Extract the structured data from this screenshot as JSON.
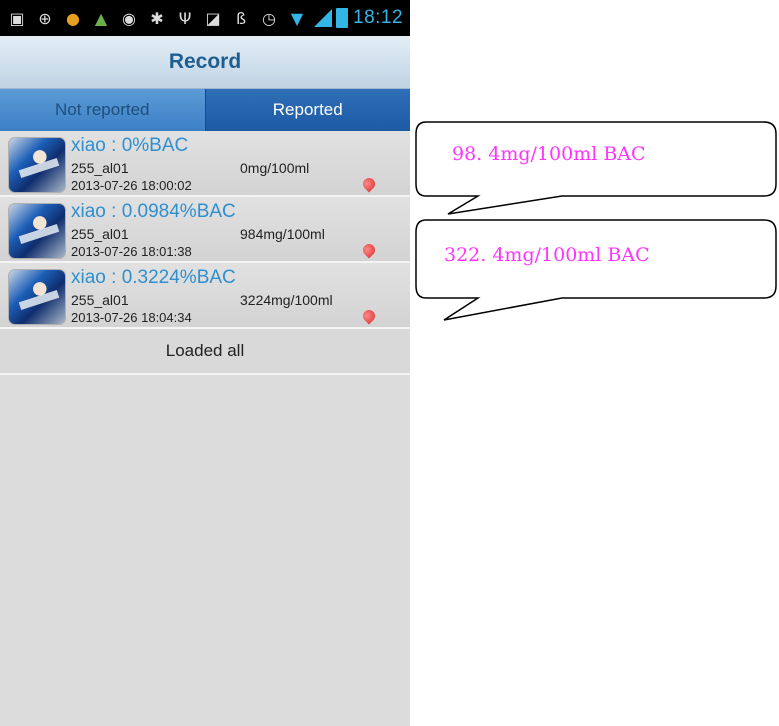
{
  "status_bar": {
    "time": "18:12",
    "icons": [
      "notification-icon",
      "gps-icon",
      "app-icon",
      "android-icon",
      "shield-icon",
      "debug-icon",
      "usb-icon",
      "image-icon",
      "bluetooth-icon",
      "alarm-icon",
      "wifi-icon",
      "signal-icon",
      "battery-icon"
    ]
  },
  "header": {
    "title": "Record"
  },
  "tabs": [
    {
      "label": "Not reported"
    },
    {
      "label": "Reported"
    }
  ],
  "records": [
    {
      "title": "xiao  : 0%BAC",
      "device": "255_al01",
      "value": "0mg/100ml",
      "time": "2013-07-26 18:00:02"
    },
    {
      "title": "xiao  : 0.0984%BAC",
      "device": "255_al01",
      "value": "984mg/100ml",
      "time": "2013-07-26 18:01:38"
    },
    {
      "title": "xiao  : 0.3224%BAC",
      "device": "255_al01",
      "value": "3224mg/100ml",
      "time": "2013-07-26 18:04:34"
    }
  ],
  "footer": {
    "loaded_all": "Loaded all"
  },
  "annotations": [
    {
      "text": "98. 4mg/100ml BAC"
    },
    {
      "text": "322. 4mg/100ml BAC"
    }
  ],
  "colors": {
    "accent": "#33b5e5",
    "title_text": "#1f5e8f",
    "tab_active": "#1e5aa4",
    "annotation_text": "#ff33ff"
  }
}
